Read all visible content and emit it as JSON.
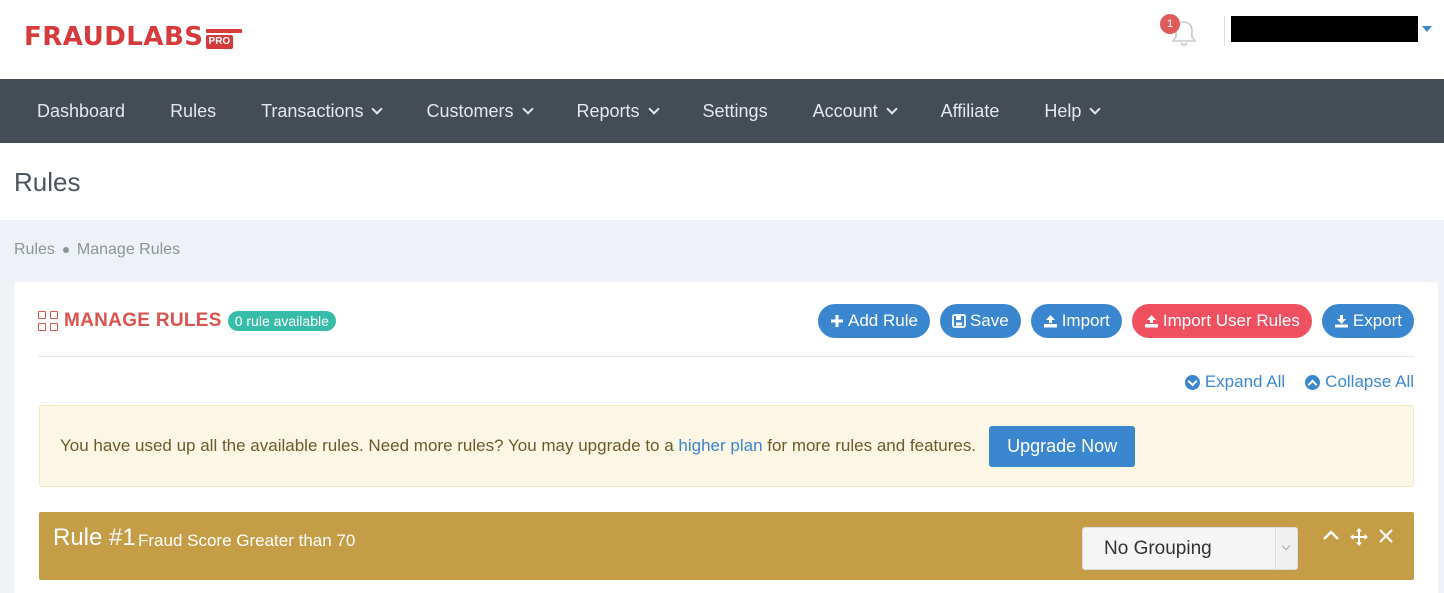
{
  "brand": {
    "name": "FRAUDLABS",
    "badge": "PRO"
  },
  "header": {
    "notification_count": "1"
  },
  "nav": {
    "items": [
      {
        "label": "Dashboard",
        "dropdown": false
      },
      {
        "label": "Rules",
        "dropdown": false
      },
      {
        "label": "Transactions",
        "dropdown": true
      },
      {
        "label": "Customers",
        "dropdown": true
      },
      {
        "label": "Reports",
        "dropdown": true
      },
      {
        "label": "Settings",
        "dropdown": false
      },
      {
        "label": "Account",
        "dropdown": true
      },
      {
        "label": "Affiliate",
        "dropdown": false
      },
      {
        "label": "Help",
        "dropdown": true
      }
    ]
  },
  "page": {
    "title": "Rules"
  },
  "breadcrumb": {
    "items": [
      "Rules",
      "Manage Rules"
    ]
  },
  "card": {
    "title": "MANAGE RULES",
    "badge": "0 rule available",
    "buttons": {
      "add": "Add Rule",
      "save": "Save",
      "import": "Import",
      "import_user": "Import User Rules",
      "export": "Export"
    },
    "expand_all": "Expand All",
    "collapse_all": "Collapse All"
  },
  "alert": {
    "text_before": "You have used up all the available rules. Need more rules? You may upgrade to a ",
    "link": "higher plan",
    "text_after": " for more rules and features.",
    "button": "Upgrade Now"
  },
  "rule": {
    "number": "Rule #1",
    "description": "Fraud Score Greater than 70",
    "grouping": "No Grouping"
  },
  "colors": {
    "brand": "#d63a3a",
    "nav_bg": "#444c56",
    "primary": "#3a87d0",
    "danger": "#ef5060",
    "rule_bar": "#c49d46",
    "badge": "#36bca8"
  }
}
